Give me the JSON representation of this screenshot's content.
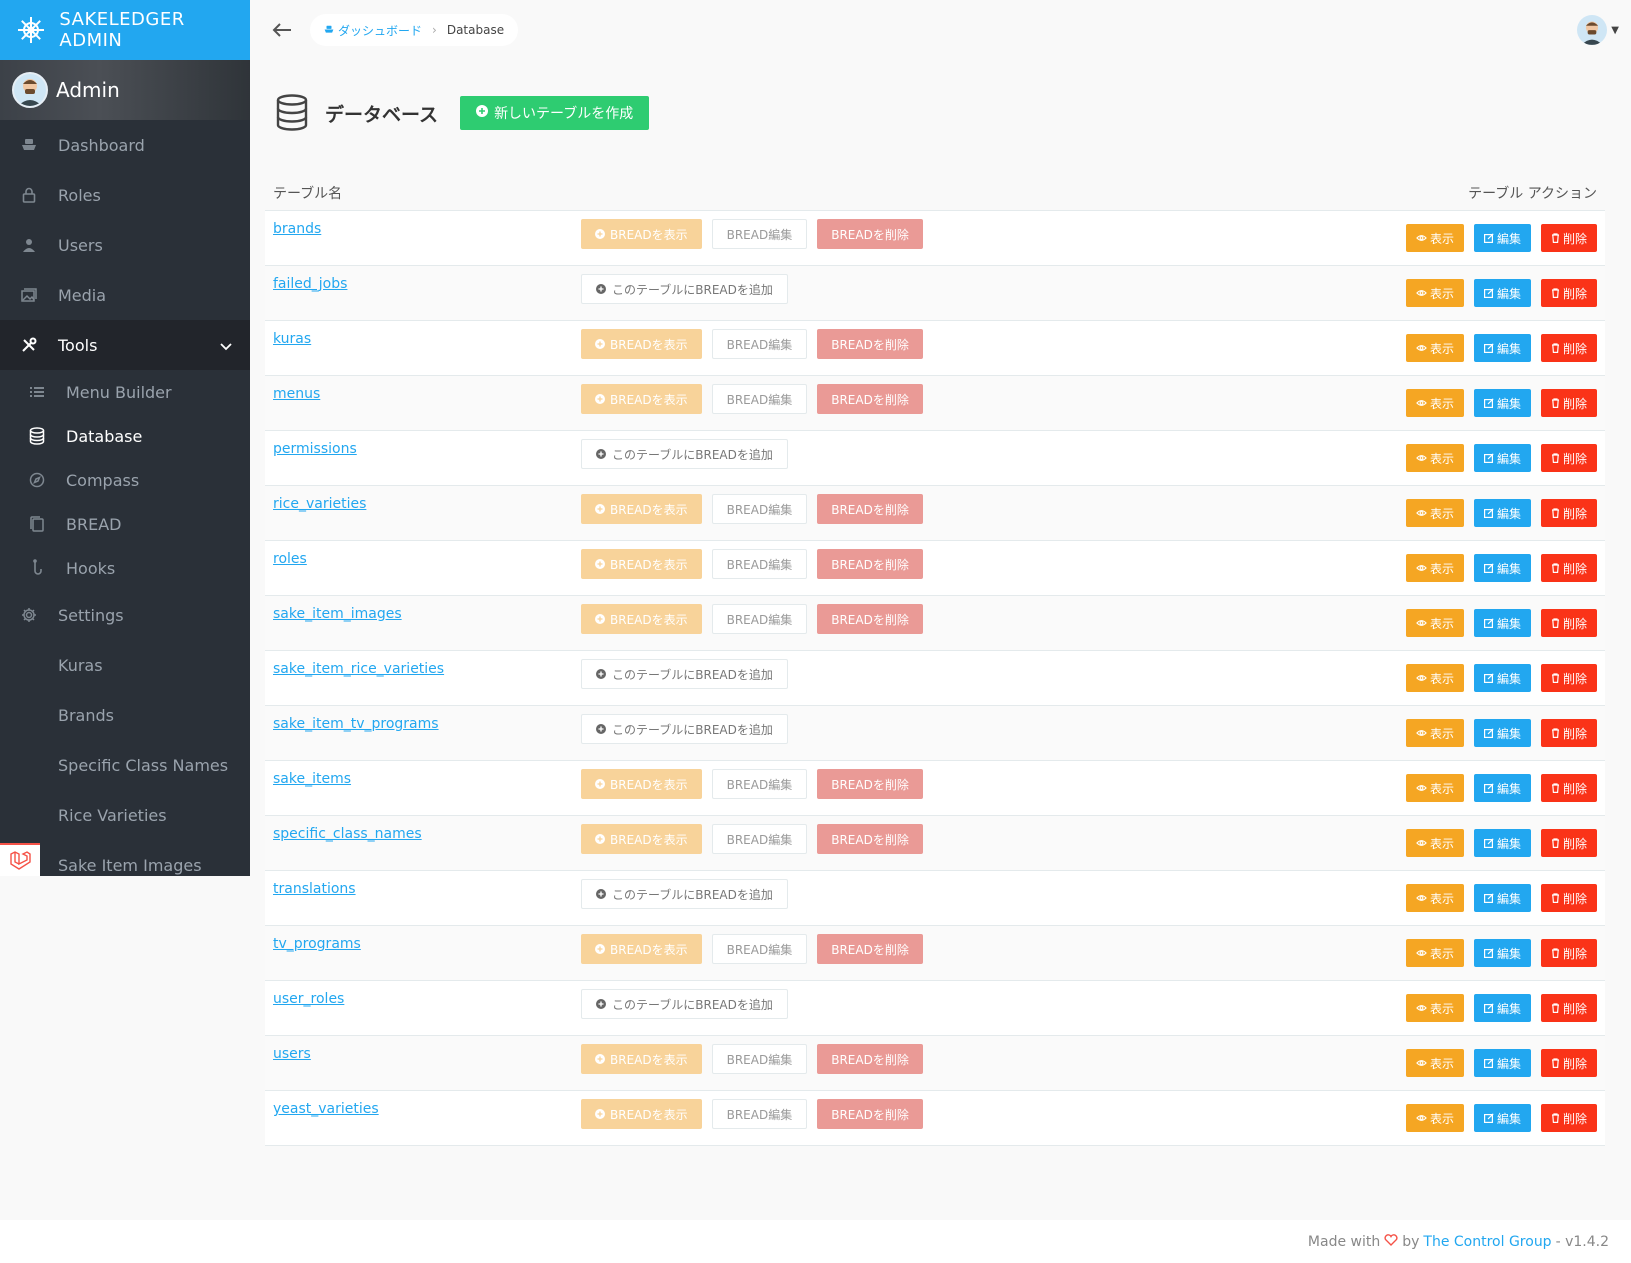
{
  "app": {
    "title": "SAKELEDGER ADMIN"
  },
  "profile": {
    "name": "Admin"
  },
  "nav": {
    "dashboard": "Dashboard",
    "roles": "Roles",
    "users": "Users",
    "media": "Media",
    "tools": "Tools",
    "tools_children": [
      "Menu Builder",
      "Database",
      "Compass",
      "BREAD",
      "Hooks"
    ],
    "settings": "Settings",
    "extra": [
      "Kuras",
      "Brands",
      "Specific Class Names",
      "Rice Varieties",
      "Sake Item Images"
    ]
  },
  "breadcrumb": {
    "home": "ダッシュボード",
    "current": "Database"
  },
  "page": {
    "title": "データベース",
    "create_label": "新しいテーブルを作成"
  },
  "table": {
    "col_name": "テーブル名",
    "col_actions": "テーブル アクション",
    "bread_show": "BREADを表示",
    "bread_edit": "BREAD編集",
    "bread_delete": "BREADを削除",
    "bread_add": "このテーブルにBREADを追加",
    "act_view": "表示",
    "act_edit": "編集",
    "act_delete": "削除",
    "rows": [
      {
        "name": "brands",
        "has_bread": true
      },
      {
        "name": "failed_jobs",
        "has_bread": false
      },
      {
        "name": "kuras",
        "has_bread": true
      },
      {
        "name": "menus",
        "has_bread": true
      },
      {
        "name": "permissions",
        "has_bread": false
      },
      {
        "name": "rice_varieties",
        "has_bread": true
      },
      {
        "name": "roles",
        "has_bread": true
      },
      {
        "name": "sake_item_images",
        "has_bread": true
      },
      {
        "name": "sake_item_rice_varieties",
        "has_bread": false
      },
      {
        "name": "sake_item_tv_programs",
        "has_bread": false
      },
      {
        "name": "sake_items",
        "has_bread": true
      },
      {
        "name": "specific_class_names",
        "has_bread": true
      },
      {
        "name": "translations",
        "has_bread": false
      },
      {
        "name": "tv_programs",
        "has_bread": true
      },
      {
        "name": "user_roles",
        "has_bread": false
      },
      {
        "name": "users",
        "has_bread": true
      },
      {
        "name": "yeast_varieties",
        "has_bread": true
      }
    ]
  },
  "footer": {
    "made_with": "Made with",
    "by": "by",
    "company": "The Control Group",
    "version": "- v1.4.2"
  },
  "colors": {
    "accent": "#22a7f0",
    "sidebar": "#2a3038",
    "success": "#2ecc71",
    "warning": "#f5a623",
    "danger": "#fa3318"
  }
}
